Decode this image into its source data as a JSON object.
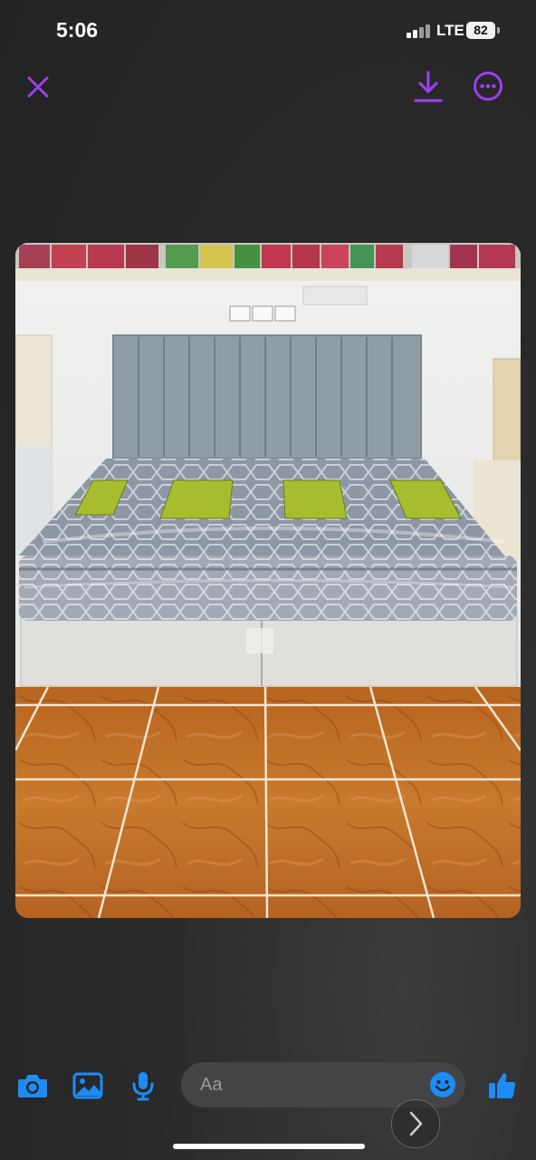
{
  "status_bar": {
    "time": "5:06",
    "network": "LTE",
    "battery": "82"
  },
  "viewer": {
    "close_icon": "close-icon",
    "download_icon": "download-icon",
    "more_icon": "more-icon"
  },
  "composer": {
    "placeholder": "Aa",
    "icons": [
      "camera-icon",
      "image-icon",
      "microphone-icon",
      "emoji-icon",
      "thumbs-up-icon"
    ]
  },
  "colors": {
    "accent_purple": "#9b3ff0",
    "accent_blue": "#1b8cf8",
    "background": "#2a2a2a"
  }
}
